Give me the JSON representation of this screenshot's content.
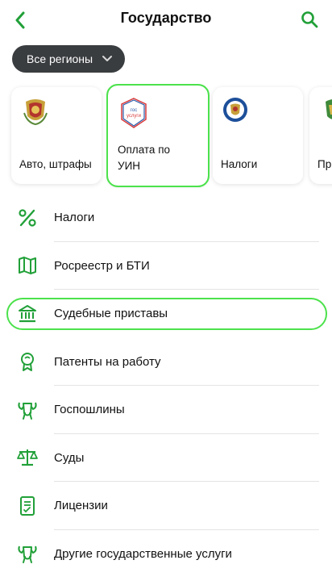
{
  "header": {
    "title": "Государство"
  },
  "region": {
    "label": "Все регионы"
  },
  "cards": [
    {
      "label": "Авто, штрафы",
      "icon": "traffic-police-emblem"
    },
    {
      "label": "Оплата по УИН",
      "icon": "gosuslugi-logo",
      "logo_text": [
        "гос",
        "услуги"
      ]
    },
    {
      "label": "Налоги",
      "icon": "tax-service-emblem"
    },
    {
      "label": "Пр",
      "icon": "emblem"
    }
  ],
  "list": [
    {
      "label": "Налоги",
      "icon": "percent-icon"
    },
    {
      "label": "Росреестр и БТИ",
      "icon": "map-icon"
    },
    {
      "label": "Судебные приставы",
      "icon": "courthouse-icon"
    },
    {
      "label": "Патенты на работу",
      "icon": "medal-icon"
    },
    {
      "label": "Госпошлины",
      "icon": "coat-of-arms-icon"
    },
    {
      "label": "Суды",
      "icon": "scales-icon"
    },
    {
      "label": "Лицензии",
      "icon": "document-icon"
    },
    {
      "label": "Другие государственные услуги",
      "icon": "coat-of-arms-icon"
    }
  ],
  "colors": {
    "accent": "#21a038",
    "highlight": "#4ce24c",
    "chip": "#3a3d40"
  }
}
